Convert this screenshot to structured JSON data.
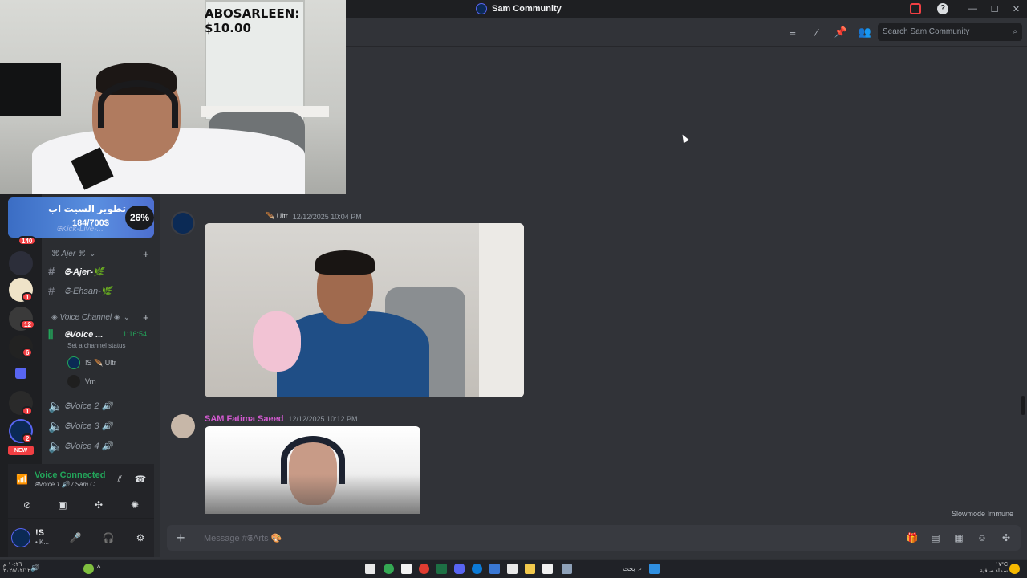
{
  "window": {
    "title": "Sam Community"
  },
  "donation": "ABOSARLEEN: $10.00",
  "header": {
    "search_placeholder": "Search Sam Community",
    "icons": [
      "threads-icon",
      "mute-notifications-icon",
      "pin-icon",
      "members-icon"
    ]
  },
  "goal": {
    "title": "تطوير السيت اب",
    "amount": "184/700$",
    "percent": "26%",
    "progress": 0.26,
    "channel_hint": "𝕾Kick-Live-..."
  },
  "rail": {
    "badges": [
      "140",
      "1",
      "12",
      "6",
      "1",
      "2"
    ],
    "new_label": "NEW"
  },
  "channels": {
    "category1": "⌘ Ajer ⌘",
    "items1": [
      {
        "name": "𝕾-Ajer-🌿",
        "active": true
      },
      {
        "name": "𝕾-Ehsan-🌿",
        "active": false
      }
    ],
    "category2": "◈ Voice Channel ◈",
    "voice_active": {
      "name": "𝕾Voice ...",
      "timer": "1:16:54",
      "status": "Set a channel status"
    },
    "voice_users": [
      "!S 🪶 Ultr",
      "Vrn"
    ],
    "voice_channels": [
      "𝕾Voice 2 🔊",
      "𝕾Voice 3 🔊",
      "𝕾Voice 4 🔊"
    ]
  },
  "voice_panel": {
    "status": "Voice Connected",
    "channel": "𝕾Voice 1 🔊 / Sam C..."
  },
  "user_panel": {
    "name": "!S",
    "sub": "• K..."
  },
  "messages": [
    {
      "author": "",
      "tag": "🪶 Ultr",
      "time": "12/12/2025 10:04 PM"
    },
    {
      "author": "SAM Fatima Saeed",
      "tag": "",
      "time": "12/12/2025 10:12 PM"
    }
  ],
  "slowmode": "Slowmode Immune",
  "composer": {
    "placeholder": "Message #𝕾Arts 🎨"
  },
  "taskbar": {
    "search": "بحث",
    "clock_time": "١٠:٢٦ م",
    "clock_date": "٢٠٢٥/١٢/١٢",
    "weather": "١٧°C",
    "weather_sub": "سماء صافية"
  }
}
